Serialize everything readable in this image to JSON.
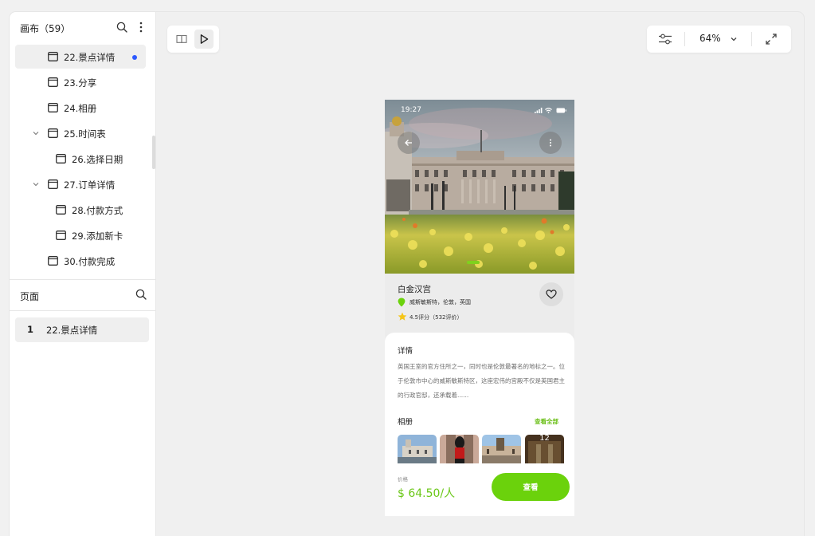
{
  "sidebar": {
    "title": "画布（59）",
    "tree": [
      {
        "label": "22.景点详情"
      },
      {
        "label": "23.分享"
      },
      {
        "label": "24.相册"
      },
      {
        "label": "25.时间表"
      },
      {
        "label": "26.选择日期"
      },
      {
        "label": "27.订单详情"
      },
      {
        "label": "28.付款方式"
      },
      {
        "label": "29.添加新卡"
      },
      {
        "label": "30.付款完成"
      }
    ],
    "pages_title": "页面",
    "pages": [
      {
        "num": "1",
        "label": "22.景点详情"
      }
    ]
  },
  "toolbar": {
    "icons": [
      "book-icon",
      "play-icon",
      "sliders-icon",
      "chevron-down-icon",
      "fullscreen-icon"
    ],
    "zoom": "64%"
  },
  "phone": {
    "time": "19:27",
    "place_name": "白金汉宫",
    "location": "威斯敏斯特，伦敦，英国",
    "rating": "4.5评分（532评价）",
    "details_heading": "详情",
    "description": "英国王室的官方住所之一，同时也是伦敦最著名的地标之一。位于伦敦市中心的威斯敏斯特区，这座宏伟的宫殿不仅是英国君主的行政官邸，还承载着......",
    "album_heading": "相册",
    "view_all": "查看全部",
    "album_more_count": "12",
    "price_label": "价格",
    "price": "$ 64.50/人",
    "cta": "查看"
  },
  "colors": {
    "accent_green": "#6bd20c",
    "price_green": "#6ac717",
    "modified_dot": "#2d59ff"
  }
}
